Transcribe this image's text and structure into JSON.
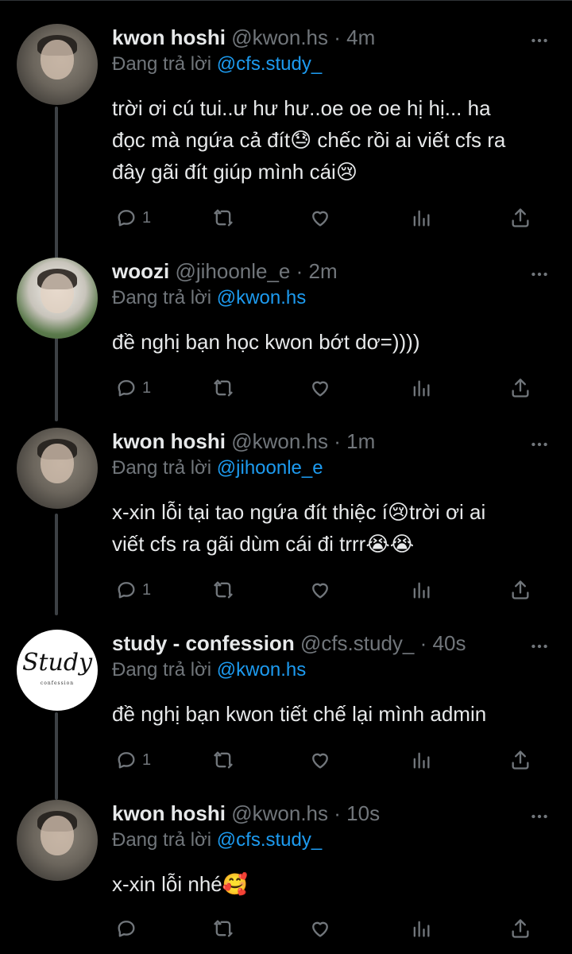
{
  "tweets": [
    {
      "name": "kwon hoshi",
      "handle": "@kwon.hs",
      "dot": "·",
      "time": "4m",
      "reply_prefix": "Đang trả lời ",
      "reply_to": "@cfs.study_",
      "text": "trời ơi cú tui..ư hư hư..oe oe oe hị hị... ha\nđọc mà ngứa cả đít😓 chếc rồi ai viết cfs ra\nđây gãi đít giúp mình cái😢",
      "reply_count": "1",
      "avatar": "kwon-hoshi-avatar"
    },
    {
      "name": "woozi",
      "handle": "@jihoonle_e",
      "dot": "·",
      "time": "2m",
      "reply_prefix": "Đang trả lời ",
      "reply_to": "@kwon.hs",
      "text": "đề nghị bạn học kwon bớt dơ=))))",
      "reply_count": "1",
      "avatar": "woozi-avatar"
    },
    {
      "name": "kwon hoshi",
      "handle": "@kwon.hs",
      "dot": "·",
      "time": "1m",
      "reply_prefix": "Đang trả lời ",
      "reply_to": "@jihoonle_e",
      "text": "x-xin lỗi tại tao ngứa đít thiệc í😢trời ơi ai\nviết cfs ra gãi dùm cái đi trrr😭😭",
      "reply_count": "1",
      "avatar": "kwon-hoshi-avatar"
    },
    {
      "name": "study - confession",
      "handle": "@cfs.study_",
      "dot": "·",
      "time": "40s",
      "reply_prefix": "Đang trả lời ",
      "reply_to": "@kwon.hs",
      "text": "đề nghị bạn kwon tiết chế lại mình admin",
      "reply_count": "1",
      "avatar": "study-confession-avatar",
      "avatar_word": "Study",
      "avatar_sub": "confession"
    },
    {
      "name": "kwon hoshi",
      "handle": "@kwon.hs",
      "dot": "·",
      "time": "10s",
      "reply_prefix": "Đang trả lời ",
      "reply_to": "@cfs.study_",
      "text": "x-xin lỗi nhé🥰",
      "reply_count": "",
      "avatar": "kwon-hoshi-avatar"
    }
  ],
  "colors": {
    "background": "#000000",
    "text": "#e7e9ea",
    "muted": "#71767b",
    "link": "#1d9bf0",
    "thread_line": "#3d4145"
  },
  "icons": [
    "reply-icon",
    "retweet-icon",
    "like-icon",
    "views-icon",
    "share-icon",
    "more-icon"
  ]
}
